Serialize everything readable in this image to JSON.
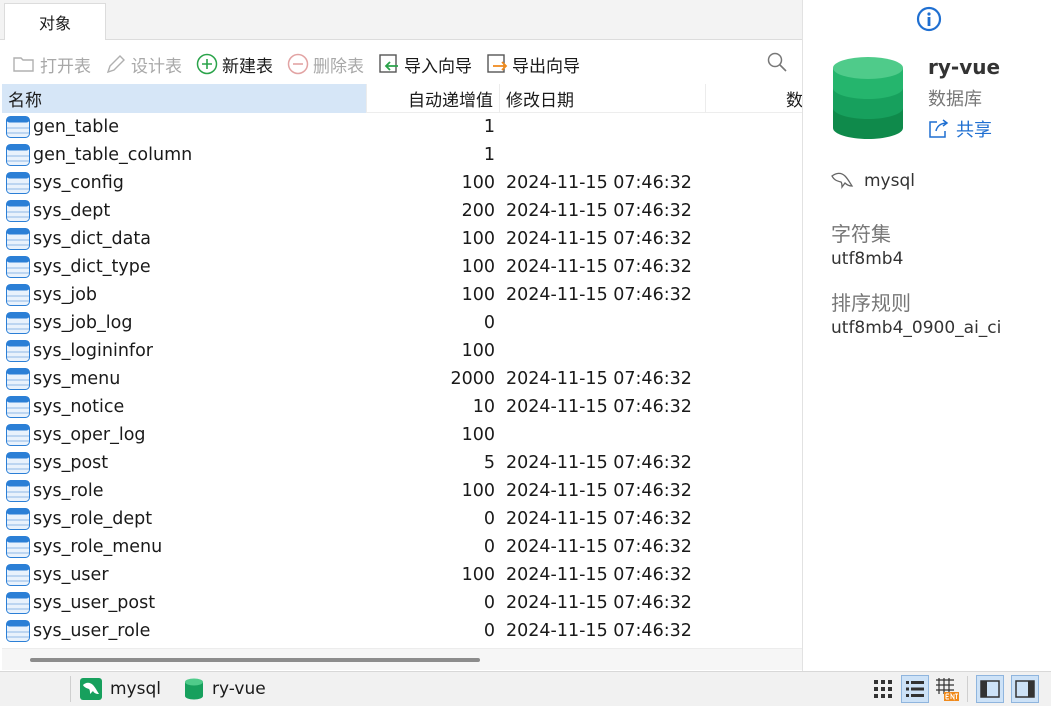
{
  "tabs": [
    {
      "label": "对象"
    }
  ],
  "toolbar": {
    "open_table": "打开表",
    "design_table": "设计表",
    "new_table": "新建表",
    "delete_table": "删除表",
    "import_wizard": "导入向导",
    "export_wizard": "导出向导"
  },
  "columns": {
    "name": "名称",
    "auto_increment": "自动递增值",
    "modified": "修改日期",
    "more": "数"
  },
  "rows": [
    {
      "name": "gen_table",
      "auto": "1",
      "date": ""
    },
    {
      "name": "gen_table_column",
      "auto": "1",
      "date": ""
    },
    {
      "name": "sys_config",
      "auto": "100",
      "date": "2024-11-15 07:46:32"
    },
    {
      "name": "sys_dept",
      "auto": "200",
      "date": "2024-11-15 07:46:32"
    },
    {
      "name": "sys_dict_data",
      "auto": "100",
      "date": "2024-11-15 07:46:32"
    },
    {
      "name": "sys_dict_type",
      "auto": "100",
      "date": "2024-11-15 07:46:32"
    },
    {
      "name": "sys_job",
      "auto": "100",
      "date": "2024-11-15 07:46:32"
    },
    {
      "name": "sys_job_log",
      "auto": "0",
      "date": ""
    },
    {
      "name": "sys_logininfor",
      "auto": "100",
      "date": ""
    },
    {
      "name": "sys_menu",
      "auto": "2000",
      "date": "2024-11-15 07:46:32"
    },
    {
      "name": "sys_notice",
      "auto": "10",
      "date": "2024-11-15 07:46:32"
    },
    {
      "name": "sys_oper_log",
      "auto": "100",
      "date": ""
    },
    {
      "name": "sys_post",
      "auto": "5",
      "date": "2024-11-15 07:46:32"
    },
    {
      "name": "sys_role",
      "auto": "100",
      "date": "2024-11-15 07:46:32"
    },
    {
      "name": "sys_role_dept",
      "auto": "0",
      "date": "2024-11-15 07:46:32"
    },
    {
      "name": "sys_role_menu",
      "auto": "0",
      "date": "2024-11-15 07:46:32"
    },
    {
      "name": "sys_user",
      "auto": "100",
      "date": "2024-11-15 07:46:32"
    },
    {
      "name": "sys_user_post",
      "auto": "0",
      "date": "2024-11-15 07:46:32"
    },
    {
      "name": "sys_user_role",
      "auto": "0",
      "date": "2024-11-15 07:46:32"
    }
  ],
  "info": {
    "db_name": "ry-vue",
    "db_kind": "数据库",
    "share": "共享",
    "connection": "mysql",
    "charset_label": "字符集",
    "charset_value": "utf8mb4",
    "collation_label": "排序规则",
    "collation_value": "utf8mb4_0900_ai_ci"
  },
  "status": {
    "connection": "mysql",
    "database": "ry-vue"
  },
  "colors": {
    "accent": "#1f6fd1",
    "table_icon": "#2b7fd6",
    "db_icon": "#17a05d",
    "header_selected": "#d6e6f7"
  },
  "icons": {
    "open_table": "folder-icon",
    "design_table": "pencil-icon",
    "new_table": "plus-circle-icon",
    "delete_table": "minus-circle-icon",
    "import_wizard": "import-icon",
    "export_wizard": "export-icon",
    "search": "search-icon",
    "info": "info-icon",
    "table": "table-icon",
    "database": "database-icon",
    "share": "share-icon",
    "mysql": "dolphin-icon"
  }
}
